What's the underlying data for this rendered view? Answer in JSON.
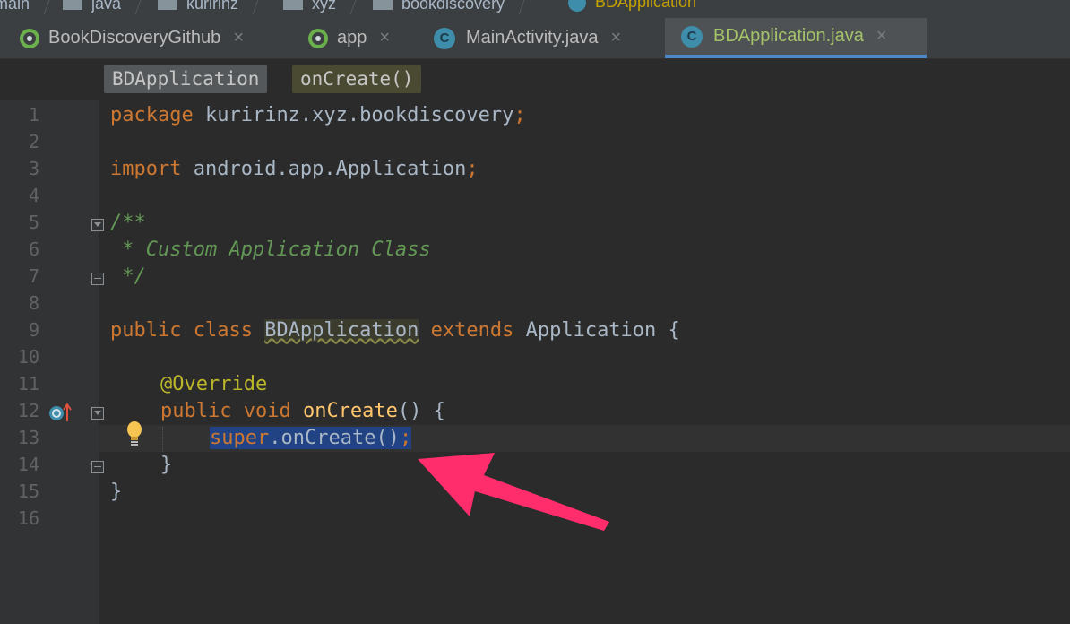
{
  "breadcrumbs": [
    {
      "label": "main",
      "active": false
    },
    {
      "label": "java",
      "active": false
    },
    {
      "label": "kuririnz",
      "active": false
    },
    {
      "label": "xyz",
      "active": false
    },
    {
      "label": "bookdiscovery",
      "active": false
    },
    {
      "label": "BDApplication",
      "active": true
    }
  ],
  "tabs": [
    {
      "label": "BookDiscoveryGithub",
      "icon": "android-module-icon",
      "active": false
    },
    {
      "label": "app",
      "icon": "android-module-icon",
      "active": false
    },
    {
      "label": "MainActivity.java",
      "icon": "class-c-icon",
      "active": false
    },
    {
      "label": "BDApplication.java",
      "icon": "class-c-icon",
      "active": true
    }
  ],
  "tab_close_glyph": "×",
  "class_icon_letter": "C",
  "navbar": {
    "class_label": "BDApplication",
    "method_label": "onCreate()"
  },
  "line_numbers": [
    "1",
    "2",
    "3",
    "4",
    "5",
    "6",
    "7",
    "8",
    "9",
    "10",
    "11",
    "12",
    "13",
    "14",
    "15",
    "16"
  ],
  "code": {
    "l1_kw": "package ",
    "l1_rest": "kuririnz.xyz.bookdiscovery",
    "l1_end": ";",
    "l3_kw": "import ",
    "l3_rest": "android.app.Application",
    "l3_end": ";",
    "l5": "/**",
    "l6": " * Custom Application Class",
    "l7": " */",
    "l9_kw1": "public class ",
    "l9_cls": "BDApplication",
    "l9_kw2": " extends ",
    "l9_rest": "Application {",
    "l11_ann": "@Override",
    "l12_kw": "public void ",
    "l12_fn": "onCreate",
    "l12_rest": "() {",
    "l13_kw": "super",
    "l13_rest": ".onCreate()",
    "l13_end": ";",
    "l14": "}",
    "l15": "}"
  },
  "colors": {
    "keyword": "#cc7832",
    "comment": "#629755",
    "annotation": "#bbb529",
    "method": "#ffc66d",
    "selection": "#214283",
    "annotation_arrow": "#ff2d6b"
  },
  "gutter_icons": [
    "override-method-icon",
    "intention-lightbulb-icon"
  ]
}
